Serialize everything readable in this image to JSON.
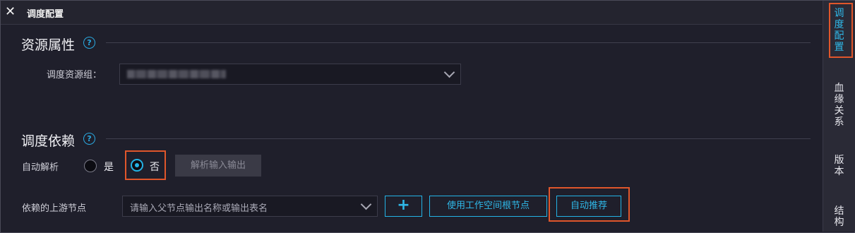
{
  "header": {
    "title": "调度配置",
    "close_icon": "close-icon"
  },
  "sidebar": {
    "items": [
      {
        "label": "调度配置",
        "active": true
      },
      {
        "label": "血缘关系",
        "active": false
      },
      {
        "label": "版本",
        "active": false
      },
      {
        "label": "结构",
        "active": false
      }
    ]
  },
  "resource_section": {
    "title": "资源属性",
    "help_icon": "question-circle-icon",
    "resource_group_label": "调度资源组："
  },
  "dependency_section": {
    "title": "调度依赖",
    "help_icon": "question-circle-icon",
    "auto_parse_label": "自动解析",
    "option_yes": "是",
    "option_no": "否",
    "selected": "否",
    "parse_button": "解析输入输出",
    "upstream_label": "依赖的上游节点",
    "upstream_placeholder": "请输入父节点输出名称或输出表名",
    "add_button": "+",
    "root_node_button": "使用工作空间根节点",
    "auto_recommend_button": "自动推荐"
  },
  "colors": {
    "accent": "#23b3e6",
    "highlight": "#e0562b",
    "background": "#1f1f2b"
  }
}
